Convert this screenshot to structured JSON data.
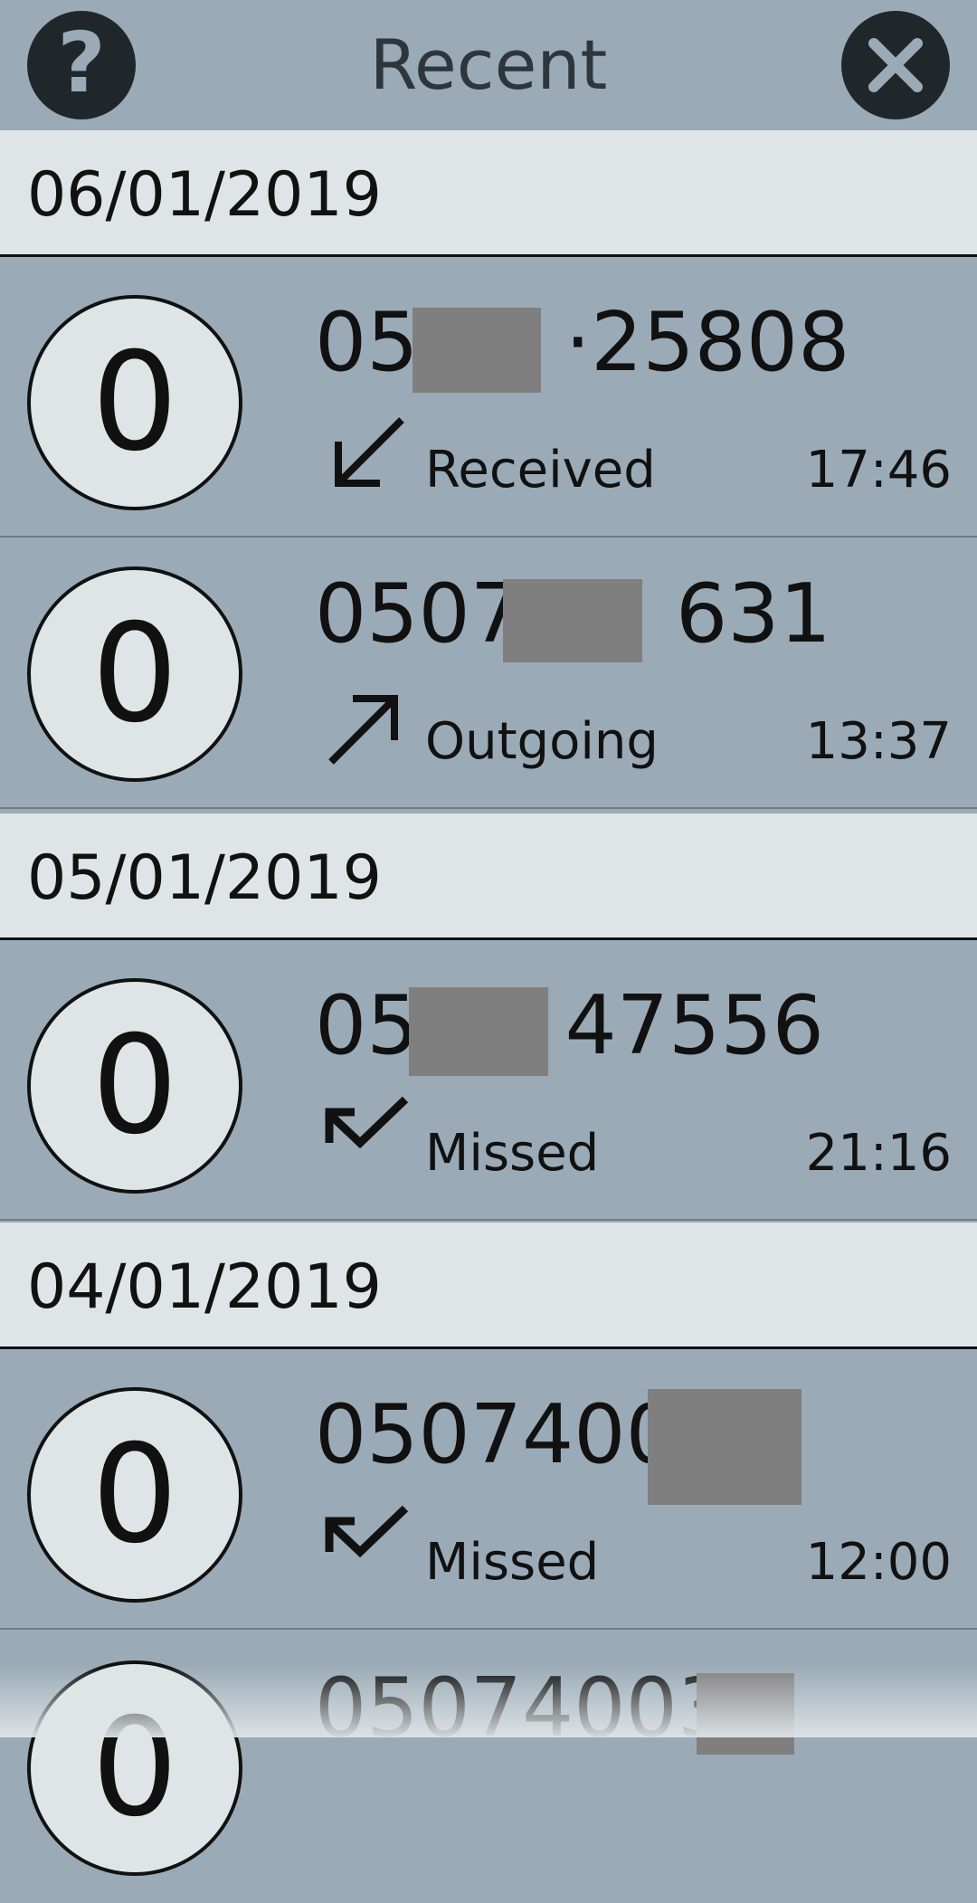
{
  "header": {
    "title": "Recent",
    "help_icon": "question-mark-icon",
    "close_icon": "close-x-icon",
    "button_color": "#20272b"
  },
  "colors": {
    "row_background": "#9aabb7",
    "date_background": "#dfe5e7",
    "redaction": "#7f7f7f"
  },
  "groups": [
    {
      "date": "06/01/2019",
      "calls": [
        {
          "avatar_letter": "0",
          "number_prefix": "05",
          "number_suffix": "·25808",
          "type": "Received",
          "type_icon": "arrow-down-left-icon",
          "time": "17:46"
        },
        {
          "avatar_letter": "0",
          "number_prefix": "0507",
          "number_suffix": "631",
          "type": "Outgoing",
          "type_icon": "arrow-up-right-icon",
          "time": "13:37"
        }
      ]
    },
    {
      "date": "05/01/2019",
      "calls": [
        {
          "avatar_letter": "0",
          "number_prefix": "05",
          "number_suffix": "47556",
          "type": "Missed",
          "type_icon": "missed-call-arrow-icon",
          "time": "21:16"
        }
      ]
    },
    {
      "date": "04/01/2019",
      "calls": [
        {
          "avatar_letter": "0",
          "number_prefix": "0507400",
          "number_suffix": "",
          "type": "Missed",
          "type_icon": "missed-call-arrow-icon",
          "time": "12:00"
        },
        {
          "avatar_letter": "0",
          "number_prefix": "05074003",
          "number_suffix": "",
          "type": "",
          "type_icon": "",
          "time": ""
        }
      ]
    }
  ]
}
